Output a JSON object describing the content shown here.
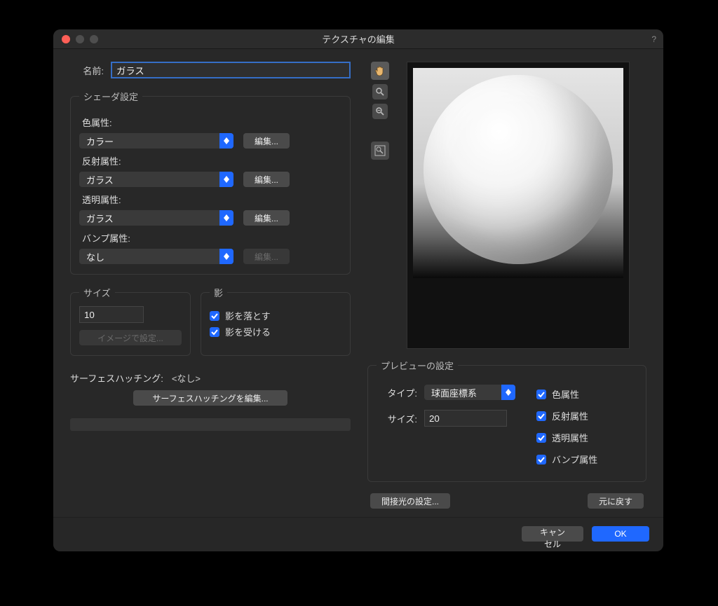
{
  "window_title": "テクスチャの編集",
  "help": "?",
  "name_label": "名前:",
  "name_value": "ガラス",
  "shader_legend": "シェーダ設定",
  "edit_btn": "編集...",
  "attrs": {
    "color_label": "色属性:",
    "color_value": "カラー",
    "refl_label": "反射属性:",
    "refl_value": "ガラス",
    "trans_label": "透明属性:",
    "trans_value": "ガラス",
    "bump_label": "バンプ属性:",
    "bump_value": "なし"
  },
  "size_legend": "サイズ",
  "size_value": "10",
  "image_btn": "イメージで設定...",
  "shadow_legend": "影",
  "cast_shadow": "影を落とす",
  "recv_shadow": "影を受ける",
  "surface_label": "サーフェスハッチング:",
  "surface_value": "<なし>",
  "surface_edit": "サーフェスハッチングを編集...",
  "preview_legend": "プレビューの設定",
  "preview_type_label": "タイプ:",
  "preview_type_value": "球面座標系",
  "preview_size_label": "サイズ:",
  "preview_size_value": "20",
  "preview_checks": {
    "color": "色属性",
    "refl": "反射属性",
    "trans": "透明属性",
    "bump": "バンプ属性"
  },
  "indirect": "間接光の設定...",
  "reset": "元に戻す",
  "cancel": "キャンセル",
  "ok": "OK"
}
